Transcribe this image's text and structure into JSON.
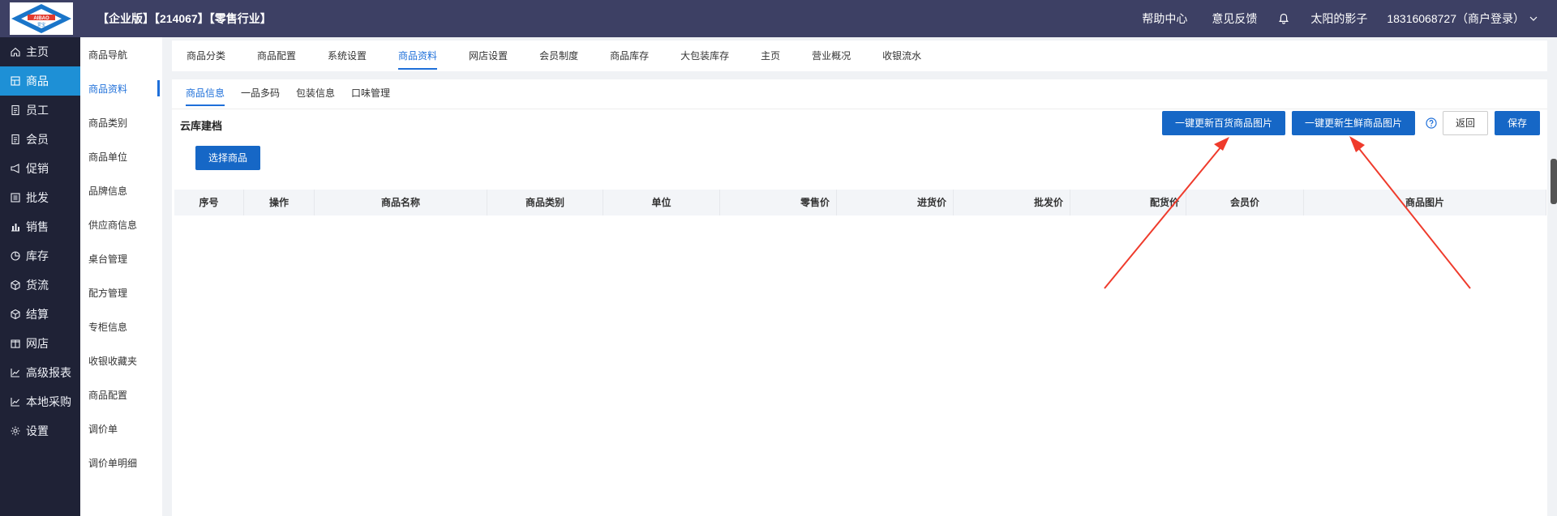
{
  "header": {
    "logo_text": "AIBAO",
    "logo_subtext": "爱宝",
    "org": "【企业版】【214067】【零售行业】",
    "help": "帮助中心",
    "feedback": "意见反馈",
    "user": "太阳的影子",
    "account": "18316068727（商户登录）"
  },
  "leftnav": [
    {
      "label": "主页",
      "icon": "home-icon"
    },
    {
      "label": "商品",
      "icon": "grid-icon",
      "active": true
    },
    {
      "label": "员工",
      "icon": "doc-icon"
    },
    {
      "label": "会员",
      "icon": "doc-icon"
    },
    {
      "label": "促销",
      "icon": "megaphone-icon"
    },
    {
      "label": "批发",
      "icon": "list-icon"
    },
    {
      "label": "销售",
      "icon": "bar-chart-icon"
    },
    {
      "label": "库存",
      "icon": "pie-icon"
    },
    {
      "label": "货流",
      "icon": "cube-icon"
    },
    {
      "label": "结算",
      "icon": "cube-icon"
    },
    {
      "label": "网店",
      "icon": "gift-icon"
    },
    {
      "label": "高级报表",
      "icon": "line-chart-icon"
    },
    {
      "label": "本地采购",
      "icon": "line-chart-icon"
    },
    {
      "label": "设置",
      "icon": "gear-icon"
    }
  ],
  "subnav": [
    {
      "label": "商品导航"
    },
    {
      "label": "商品资料",
      "active": true
    },
    {
      "label": "商品类别"
    },
    {
      "label": "商品单位"
    },
    {
      "label": "品牌信息"
    },
    {
      "label": "供应商信息"
    },
    {
      "label": "桌台管理"
    },
    {
      "label": "配方管理"
    },
    {
      "label": "专柜信息"
    },
    {
      "label": "收银收藏夹"
    },
    {
      "label": "商品配置"
    },
    {
      "label": "调价单"
    },
    {
      "label": "调价单明细"
    }
  ],
  "top_tabs": [
    {
      "label": "商品分类"
    },
    {
      "label": "商品配置"
    },
    {
      "label": "系统设置"
    },
    {
      "label": "商品资料",
      "active": true
    },
    {
      "label": "网店设置"
    },
    {
      "label": "会员制度"
    },
    {
      "label": "商品库存"
    },
    {
      "label": "大包装库存"
    },
    {
      "label": "主页"
    },
    {
      "label": "营业概况"
    },
    {
      "label": "收银流水"
    }
  ],
  "sub_tabs": [
    {
      "label": "商品信息",
      "active": true
    },
    {
      "label": "一品多码"
    },
    {
      "label": "包装信息"
    },
    {
      "label": "口味管理"
    }
  ],
  "section_title": "云库建档",
  "buttons": {
    "update_general": "一键更新百货商品图片",
    "update_fresh": "一键更新生鲜商品图片",
    "back": "返回",
    "save": "保存",
    "select_product": "选择商品"
  },
  "table": {
    "columns": [
      {
        "label": "序号",
        "align": "center"
      },
      {
        "label": "操作",
        "align": "center"
      },
      {
        "label": "商品名称",
        "align": "center"
      },
      {
        "label": "商品类别",
        "align": "center"
      },
      {
        "label": "单位",
        "align": "center"
      },
      {
        "label": "零售价",
        "align": "right"
      },
      {
        "label": "进货价",
        "align": "right"
      },
      {
        "label": "批发价",
        "align": "right"
      },
      {
        "label": "配货价",
        "align": "right"
      },
      {
        "label": "会员价",
        "align": "center"
      },
      {
        "label": "商品图片",
        "align": "center"
      }
    ]
  },
  "colors": {
    "topbar": "#3d4064",
    "leftnav": "#1f2236",
    "active_nav": "#1e90d6",
    "primary": "#1667c6",
    "arrow": "#ef3b2c"
  }
}
